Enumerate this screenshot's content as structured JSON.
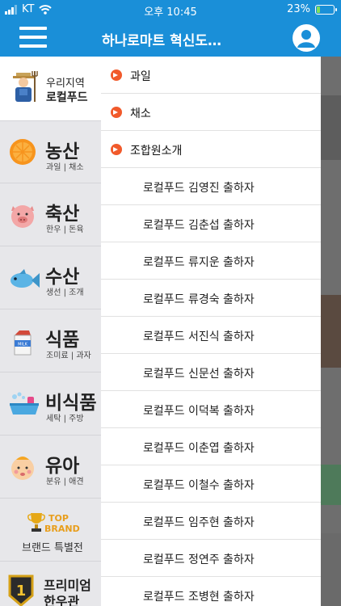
{
  "status": {
    "carrier": "KT",
    "time": "오후 10:45",
    "battery": "23%",
    "battery_level": 0.23
  },
  "header": {
    "title": "하나로마트 혁신도…"
  },
  "categories": [
    {
      "icon": "farmer-icon",
      "name_top": "우리지역",
      "name_bottom": "로컬푸드",
      "active": true
    },
    {
      "icon": "orange-icon",
      "name": "농산",
      "sub": "과일 | 채소"
    },
    {
      "icon": "pig-icon",
      "name": "축산",
      "sub": "한우 | 돈육"
    },
    {
      "icon": "fish-icon",
      "name": "수산",
      "sub": "생선 | 조개"
    },
    {
      "icon": "milk-carton-icon",
      "name": "식품",
      "sub": "조미료 | 과자"
    },
    {
      "icon": "bathtub-icon",
      "name": "비식품",
      "sub": "세탁 | 주방"
    },
    {
      "icon": "baby-icon",
      "name": "유아",
      "sub": "분유 | 애견"
    },
    {
      "icon": "trophy-icon",
      "badge_top": "TOP",
      "badge_bottom": "BRAND",
      "name": "브랜드 특별전"
    },
    {
      "icon": "medal-icon",
      "badge": "1",
      "name": "프리미엄 한우관"
    }
  ],
  "menu": {
    "sections": [
      {
        "label": "과일"
      },
      {
        "label": "채소"
      },
      {
        "label": "조합원소개"
      }
    ],
    "producers": [
      "로컬푸드 김영진 출하자",
      "로컬푸드 김춘섭 출하자",
      "로컬푸드 류지운 출하자",
      "로컬푸드 류경숙 출하자",
      "로컬푸드 서진식 출하자",
      "로컬푸드 신문선 출하자",
      "로컬푸드 이덕복 출하자",
      "로컬푸드 이춘엽 출하자",
      "로컬푸드 이철수 출하자",
      "로컬푸드 임주현 출하자",
      "로컬푸드 정연주 출하자",
      "로컬푸드 조병현 출하자"
    ]
  },
  "colors": {
    "header": "#1a8fd8",
    "arrow": "#f15a2b"
  }
}
